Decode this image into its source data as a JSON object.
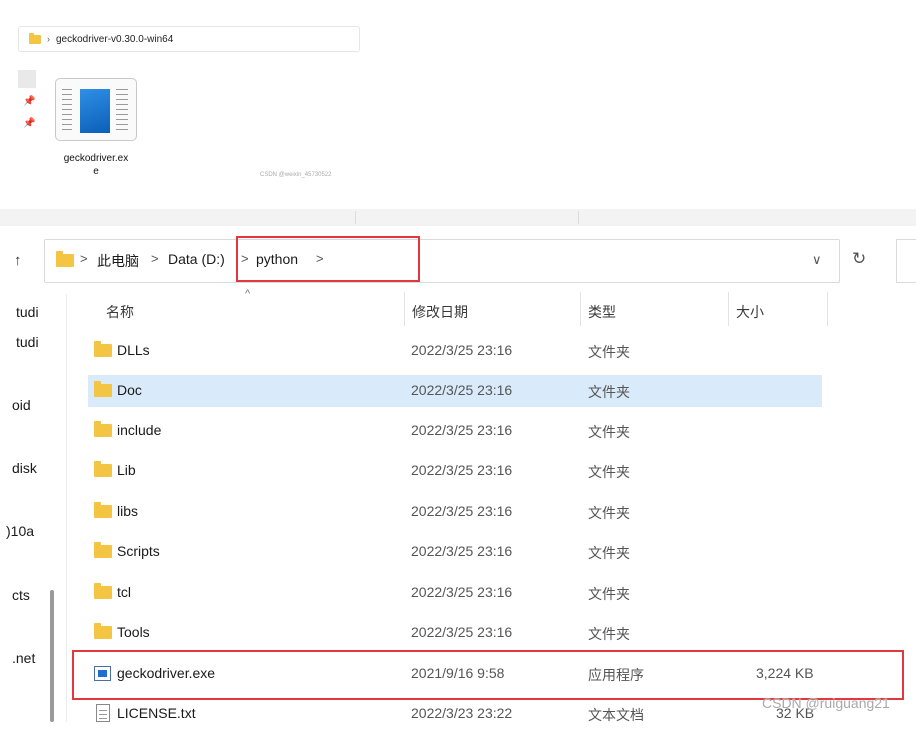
{
  "inset": {
    "breadcrumb_path": "geckodriver-v0.30.0-win64",
    "file_name_line1": "geckodriver.ex",
    "file_name_line2": "e",
    "watermark": "CSDN @weixin_45730522"
  },
  "address_bar": {
    "crumbs": [
      "此电脑",
      "Data (D:)",
      "python"
    ],
    "separator": ">",
    "dropdown_icon": "chevron-down-icon",
    "refresh_icon": "refresh-icon"
  },
  "nav_fragments": [
    "tudi",
    "tudi",
    "oid",
    "disk",
    ")10a",
    "cts",
    ".net"
  ],
  "columns": {
    "name": "名称",
    "date": "修改日期",
    "type": "类型",
    "size": "大小"
  },
  "files": [
    {
      "name": "DLLs",
      "date": "2022/3/25 23:16",
      "type": "文件夹",
      "size": "",
      "icon": "folder-icon"
    },
    {
      "name": "Doc",
      "date": "2022/3/25 23:16",
      "type": "文件夹",
      "size": "",
      "icon": "folder-icon",
      "selected": true
    },
    {
      "name": "include",
      "date": "2022/3/25 23:16",
      "type": "文件夹",
      "size": "",
      "icon": "folder-icon"
    },
    {
      "name": "Lib",
      "date": "2022/3/25 23:16",
      "type": "文件夹",
      "size": "",
      "icon": "folder-icon"
    },
    {
      "name": "libs",
      "date": "2022/3/25 23:16",
      "type": "文件夹",
      "size": "",
      "icon": "folder-icon"
    },
    {
      "name": "Scripts",
      "date": "2022/3/25 23:16",
      "type": "文件夹",
      "size": "",
      "icon": "folder-icon"
    },
    {
      "name": "tcl",
      "date": "2022/3/25 23:16",
      "type": "文件夹",
      "size": "",
      "icon": "folder-icon"
    },
    {
      "name": "Tools",
      "date": "2022/3/25 23:16",
      "type": "文件夹",
      "size": "",
      "icon": "folder-icon"
    },
    {
      "name": "geckodriver.exe",
      "date": "2021/9/16 9:58",
      "type": "应用程序",
      "size": "3,224 KB",
      "icon": "exe-icon"
    },
    {
      "name": "LICENSE.txt",
      "date": "2022/3/23 23:22",
      "type": "文本文档",
      "size": "32 KB",
      "icon": "txt-icon"
    }
  ],
  "watermark": "CSDN @ruiguang21",
  "colors": {
    "highlight_border": "#e0383e",
    "selected_row": "#d9ebfa",
    "folder": "#f4c542"
  }
}
